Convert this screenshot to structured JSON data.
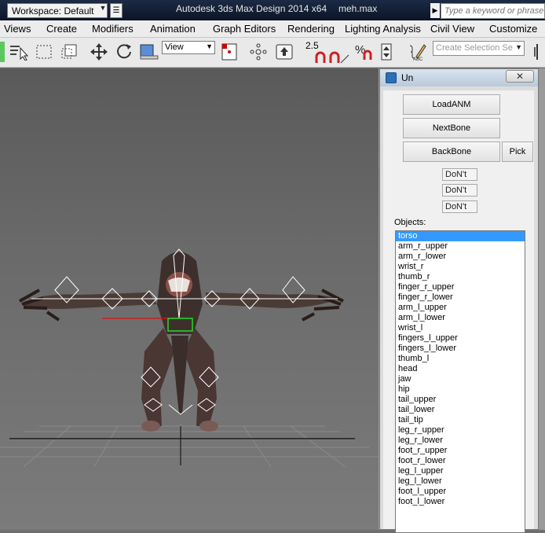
{
  "titlebar": {
    "workspace": "Workspace: Default",
    "app_title": "Autodesk 3ds Max Design 2014 x64",
    "file_name": "meh.max",
    "search_placeholder": "Type a keyword or phrase"
  },
  "menu": [
    "Views",
    "Create",
    "Modifiers",
    "Animation",
    "Graph Editors",
    "Rendering",
    "Lighting Analysis",
    "Civil View",
    "Customize"
  ],
  "toolbar": {
    "view_select": "View",
    "snap_value": "2.5",
    "selection_set_placeholder": "Create Selection Se"
  },
  "dialog": {
    "title": "Un",
    "close": "✕",
    "buttons": {
      "load": "LoadANM",
      "next": "NextBone",
      "back": "BackBone",
      "pick": "Pick"
    },
    "fields": [
      "DoN't",
      "DoN't",
      "DoN't"
    ],
    "objects_label": "Objects:",
    "objects": [
      "torso",
      "arm_r_upper",
      "arm_r_lower",
      "wrist_r",
      "thumb_r",
      "finger_r_upper",
      "finger_r_lower",
      "arm_l_upper",
      "arm_l_lower",
      "wrist_l",
      "fingers_l_upper",
      "fingers_l_lower",
      "thumb_l",
      "head",
      "jaw",
      "hip",
      "tail_upper",
      "tail_lower",
      "tail_tip",
      "leg_r_upper",
      "leg_r_lower",
      "foot_r_upper",
      "foot_r_lower",
      "leg_l_upper",
      "leg_l_lower",
      "foot_l_upper",
      "foot_l_lower"
    ],
    "selected_object": "torso"
  }
}
